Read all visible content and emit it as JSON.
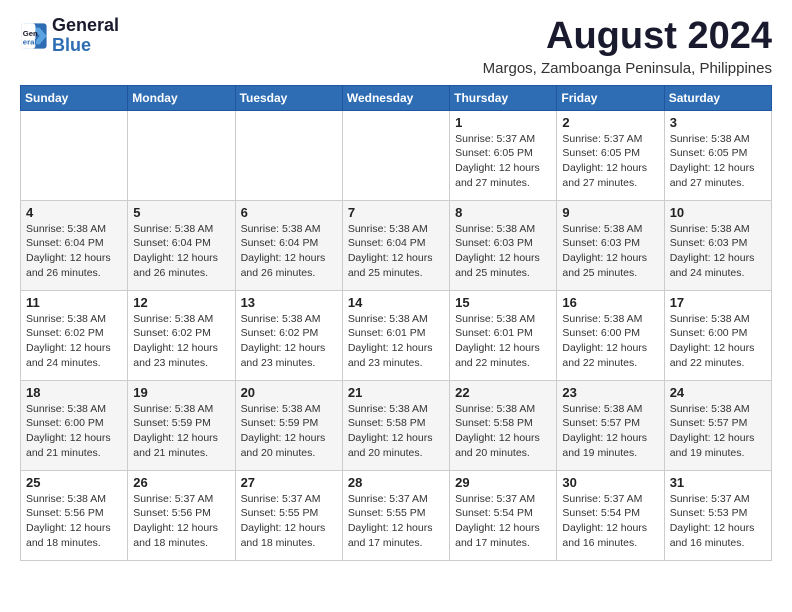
{
  "header": {
    "logo_line1": "General",
    "logo_line2": "Blue",
    "title": "August 2024",
    "subtitle": "Margos, Zamboanga Peninsula, Philippines"
  },
  "calendar": {
    "weekdays": [
      "Sunday",
      "Monday",
      "Tuesday",
      "Wednesday",
      "Thursday",
      "Friday",
      "Saturday"
    ],
    "weeks": [
      [
        {
          "day": "",
          "info": ""
        },
        {
          "day": "",
          "info": ""
        },
        {
          "day": "",
          "info": ""
        },
        {
          "day": "",
          "info": ""
        },
        {
          "day": "1",
          "info": "Sunrise: 5:37 AM\nSunset: 6:05 PM\nDaylight: 12 hours\nand 27 minutes."
        },
        {
          "day": "2",
          "info": "Sunrise: 5:37 AM\nSunset: 6:05 PM\nDaylight: 12 hours\nand 27 minutes."
        },
        {
          "day": "3",
          "info": "Sunrise: 5:38 AM\nSunset: 6:05 PM\nDaylight: 12 hours\nand 27 minutes."
        }
      ],
      [
        {
          "day": "4",
          "info": "Sunrise: 5:38 AM\nSunset: 6:04 PM\nDaylight: 12 hours\nand 26 minutes."
        },
        {
          "day": "5",
          "info": "Sunrise: 5:38 AM\nSunset: 6:04 PM\nDaylight: 12 hours\nand 26 minutes."
        },
        {
          "day": "6",
          "info": "Sunrise: 5:38 AM\nSunset: 6:04 PM\nDaylight: 12 hours\nand 26 minutes."
        },
        {
          "day": "7",
          "info": "Sunrise: 5:38 AM\nSunset: 6:04 PM\nDaylight: 12 hours\nand 25 minutes."
        },
        {
          "day": "8",
          "info": "Sunrise: 5:38 AM\nSunset: 6:03 PM\nDaylight: 12 hours\nand 25 minutes."
        },
        {
          "day": "9",
          "info": "Sunrise: 5:38 AM\nSunset: 6:03 PM\nDaylight: 12 hours\nand 25 minutes."
        },
        {
          "day": "10",
          "info": "Sunrise: 5:38 AM\nSunset: 6:03 PM\nDaylight: 12 hours\nand 24 minutes."
        }
      ],
      [
        {
          "day": "11",
          "info": "Sunrise: 5:38 AM\nSunset: 6:02 PM\nDaylight: 12 hours\nand 24 minutes."
        },
        {
          "day": "12",
          "info": "Sunrise: 5:38 AM\nSunset: 6:02 PM\nDaylight: 12 hours\nand 23 minutes."
        },
        {
          "day": "13",
          "info": "Sunrise: 5:38 AM\nSunset: 6:02 PM\nDaylight: 12 hours\nand 23 minutes."
        },
        {
          "day": "14",
          "info": "Sunrise: 5:38 AM\nSunset: 6:01 PM\nDaylight: 12 hours\nand 23 minutes."
        },
        {
          "day": "15",
          "info": "Sunrise: 5:38 AM\nSunset: 6:01 PM\nDaylight: 12 hours\nand 22 minutes."
        },
        {
          "day": "16",
          "info": "Sunrise: 5:38 AM\nSunset: 6:00 PM\nDaylight: 12 hours\nand 22 minutes."
        },
        {
          "day": "17",
          "info": "Sunrise: 5:38 AM\nSunset: 6:00 PM\nDaylight: 12 hours\nand 22 minutes."
        }
      ],
      [
        {
          "day": "18",
          "info": "Sunrise: 5:38 AM\nSunset: 6:00 PM\nDaylight: 12 hours\nand 21 minutes."
        },
        {
          "day": "19",
          "info": "Sunrise: 5:38 AM\nSunset: 5:59 PM\nDaylight: 12 hours\nand 21 minutes."
        },
        {
          "day": "20",
          "info": "Sunrise: 5:38 AM\nSunset: 5:59 PM\nDaylight: 12 hours\nand 20 minutes."
        },
        {
          "day": "21",
          "info": "Sunrise: 5:38 AM\nSunset: 5:58 PM\nDaylight: 12 hours\nand 20 minutes."
        },
        {
          "day": "22",
          "info": "Sunrise: 5:38 AM\nSunset: 5:58 PM\nDaylight: 12 hours\nand 20 minutes."
        },
        {
          "day": "23",
          "info": "Sunrise: 5:38 AM\nSunset: 5:57 PM\nDaylight: 12 hours\nand 19 minutes."
        },
        {
          "day": "24",
          "info": "Sunrise: 5:38 AM\nSunset: 5:57 PM\nDaylight: 12 hours\nand 19 minutes."
        }
      ],
      [
        {
          "day": "25",
          "info": "Sunrise: 5:38 AM\nSunset: 5:56 PM\nDaylight: 12 hours\nand 18 minutes."
        },
        {
          "day": "26",
          "info": "Sunrise: 5:37 AM\nSunset: 5:56 PM\nDaylight: 12 hours\nand 18 minutes."
        },
        {
          "day": "27",
          "info": "Sunrise: 5:37 AM\nSunset: 5:55 PM\nDaylight: 12 hours\nand 18 minutes."
        },
        {
          "day": "28",
          "info": "Sunrise: 5:37 AM\nSunset: 5:55 PM\nDaylight: 12 hours\nand 17 minutes."
        },
        {
          "day": "29",
          "info": "Sunrise: 5:37 AM\nSunset: 5:54 PM\nDaylight: 12 hours\nand 17 minutes."
        },
        {
          "day": "30",
          "info": "Sunrise: 5:37 AM\nSunset: 5:54 PM\nDaylight: 12 hours\nand 16 minutes."
        },
        {
          "day": "31",
          "info": "Sunrise: 5:37 AM\nSunset: 5:53 PM\nDaylight: 12 hours\nand 16 minutes."
        }
      ]
    ]
  }
}
